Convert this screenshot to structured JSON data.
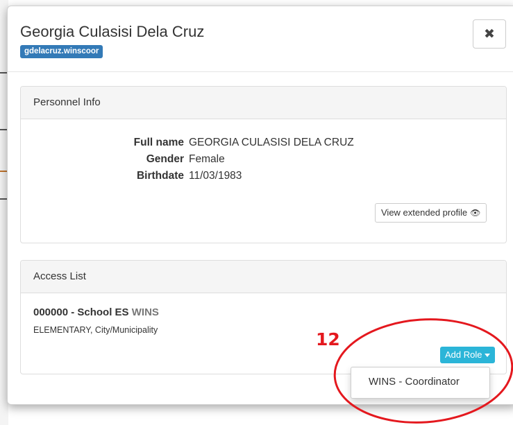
{
  "modal": {
    "title": "Georgia Culasisi Dela Cruz",
    "username_badge": "gdelacruz.winscoor",
    "close_glyph": "✖"
  },
  "personnel": {
    "heading": "Personnel Info",
    "fields": [
      {
        "label": "Full name",
        "value": "GEORGIA CULASISI DELA CRUZ"
      },
      {
        "label": "Gender",
        "value": "Female"
      },
      {
        "label": "Birthdate",
        "value": "11/03/1983"
      }
    ],
    "extended_button": "View extended profile",
    "eye_glyph": "👁"
  },
  "access": {
    "heading": "Access List",
    "school_name": "000000 - School ES",
    "program": "WINS",
    "school_details": "ELEMENTARY, City/Municipality",
    "add_role_button": "Add Role",
    "dropdown_items": [
      "WINS - Coordinator"
    ]
  },
  "annotation": {
    "number": "12",
    "color": "#e4181e"
  },
  "colors": {
    "badge": "#337ab7",
    "add_role": "#2bb5d8"
  }
}
